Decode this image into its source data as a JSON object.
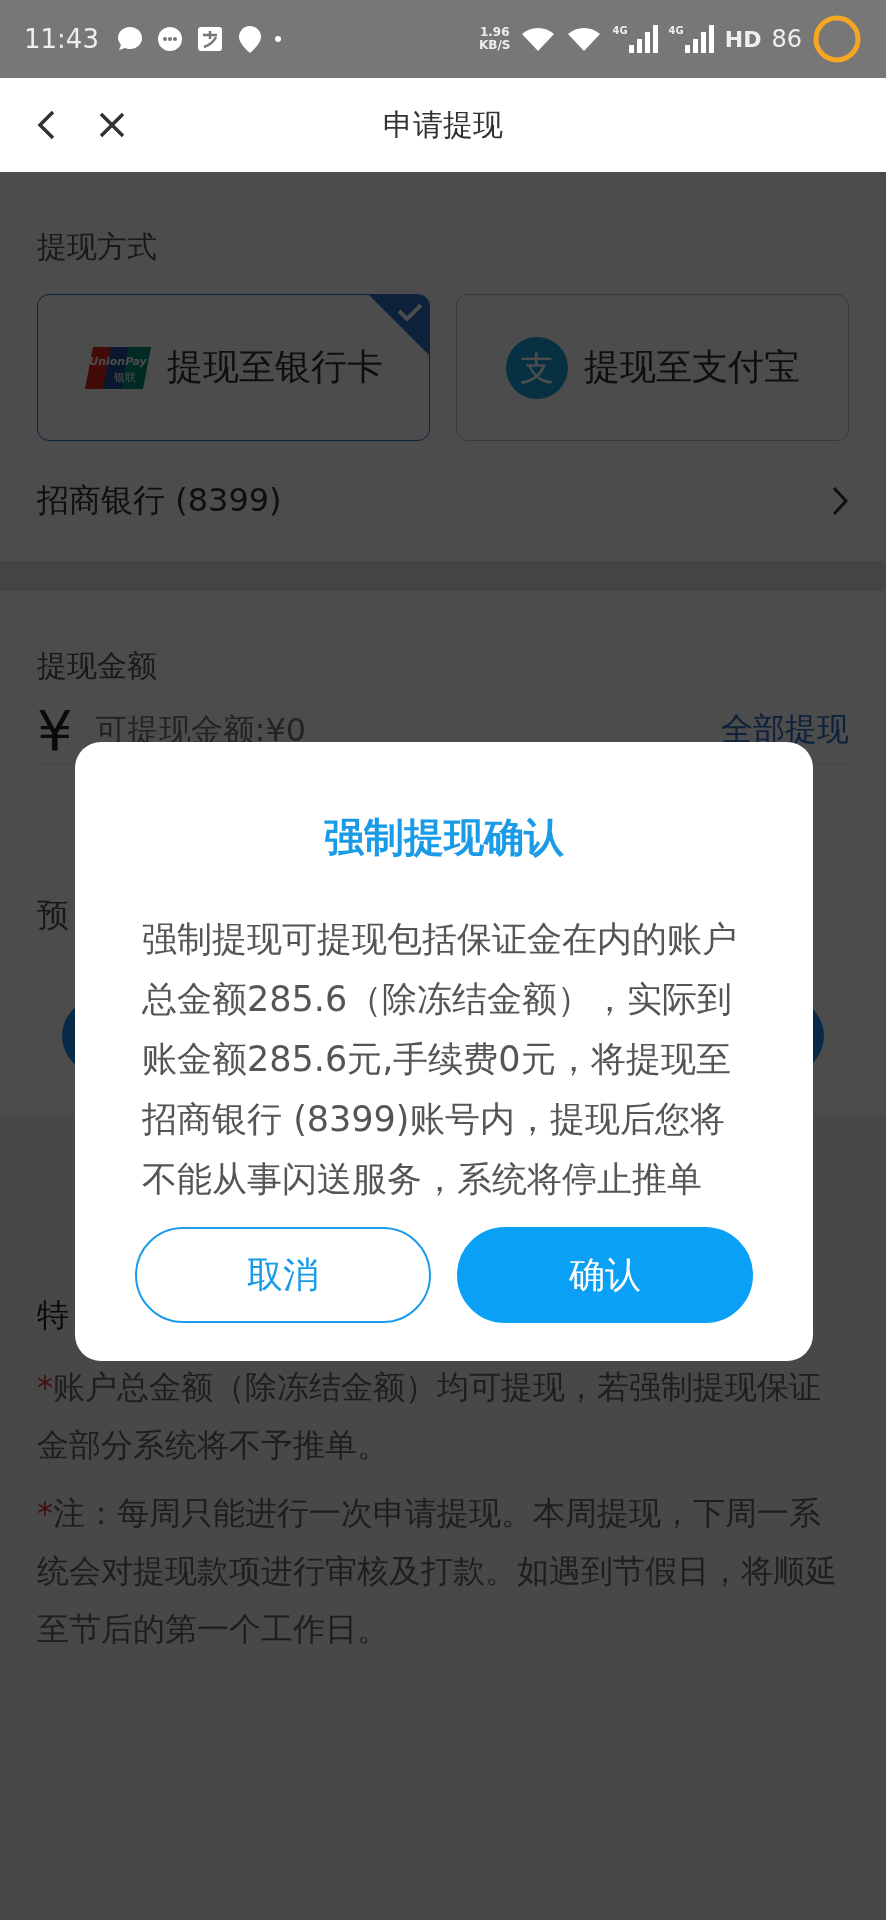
{
  "status_bar": {
    "time": "11:43",
    "net_speed": "1.96",
    "net_unit": "KB/S",
    "signals": [
      {
        "label": "4G"
      },
      {
        "label": "4G"
      }
    ],
    "hd": "HD",
    "battery": "86"
  },
  "header": {
    "title": "申请提现"
  },
  "method": {
    "label": "提现方式",
    "options": [
      {
        "kind": "unionpay",
        "logo_text": "UnionPay",
        "logo_sub": "银联",
        "label": "提现至银行卡",
        "selected": true
      },
      {
        "kind": "alipay",
        "logo_text": "支",
        "label": "提现至支付宝",
        "selected": false
      }
    ]
  },
  "bank": {
    "name": "招商银行 (8399)"
  },
  "amount": {
    "label": "提现金额",
    "currency": "¥",
    "placeholder": "可提现金额:¥0",
    "withdraw_all": "全部提现"
  },
  "estimate_label": "预",
  "notes": {
    "title": "特",
    "items": [
      {
        "mark": "*",
        "text": "账户总金额（除冻结金额）均可提现，若强制提现保证金部分系统将不予推单。"
      },
      {
        "mark": "*",
        "text": "注：每周只能进行一次申请提现。本周提现，下周一系统会对提现款项进行审核及打款。如遇到节假日，将顺延至节后的第一个工作日。"
      }
    ]
  },
  "dialog": {
    "title": "强制提现确认",
    "message": "强制提现可提现包括保证金在内的账户总金额285.6（除冻结金额），实际到账金额285.6元,手续费0元，将提现至招商银行 (8399)账号内，提现后您将不能从事闪送服务，系统将停止推单",
    "buttons": [
      {
        "kind": "secondary",
        "label": "取消"
      },
      {
        "kind": "primary",
        "label": "确认"
      }
    ]
  }
}
